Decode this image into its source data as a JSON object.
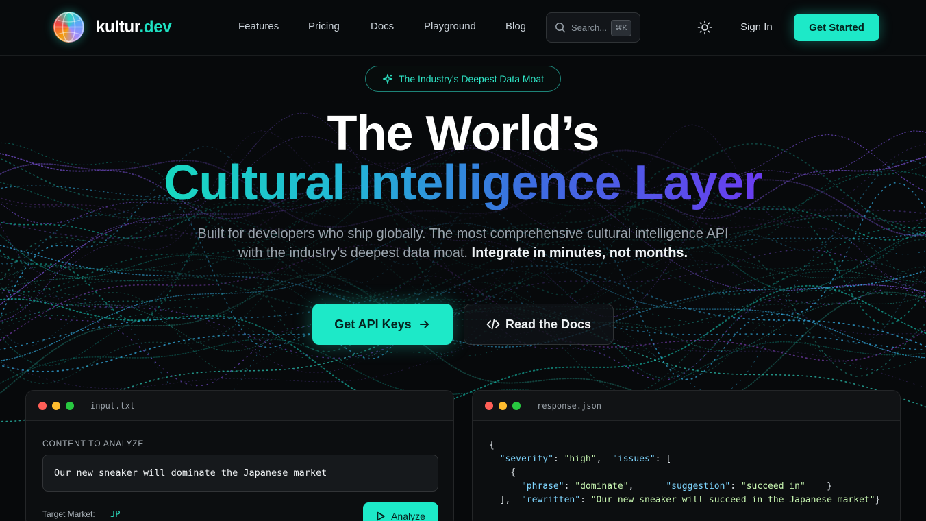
{
  "brand": {
    "name_main": "kultur",
    "name_accent": ".dev"
  },
  "nav": {
    "items": [
      "Features",
      "Pricing",
      "Docs",
      "Playground",
      "Blog"
    ]
  },
  "search": {
    "placeholder": "Search...",
    "shortcut": "⌘K"
  },
  "auth": {
    "sign_in": "Sign In",
    "get_started": "Get Started"
  },
  "hero": {
    "pill": "The Industry's Deepest Data Moat",
    "title_line1": "The World’s",
    "title_line2": "Cultural Intelligence Layer",
    "subtitle": "Built for developers who ship globally. The most comprehensive cultural intelligence API with the industry's deepest data moat. ",
    "subtitle_bold": "Integrate in minutes, not months.",
    "cta_primary": "Get API Keys",
    "cta_secondary": "Read the Docs"
  },
  "input_panel": {
    "filename": "input.txt",
    "label": "CONTENT TO ANALYZE",
    "content": "Our new sneaker will dominate the Japanese market",
    "target_label": "Target Market:",
    "target_value": "JP",
    "analyze_label": "Analyze"
  },
  "response_panel": {
    "filename": "response.json",
    "severity": "high",
    "phrase": "dominate",
    "suggestion": "succeed in",
    "rewritten": "Our new sneaker will succeed in the Japanese market"
  },
  "colors": {
    "accent": "#1de9c8",
    "bg": "#07090b",
    "gradient_end": "#6a3cf0"
  }
}
